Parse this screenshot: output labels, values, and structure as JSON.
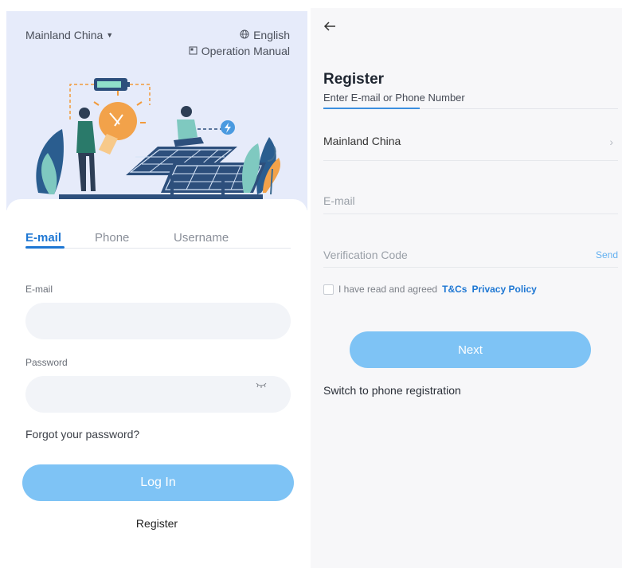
{
  "login": {
    "region": "Mainland China",
    "language": "English",
    "manual": "Operation Manual",
    "tabs": [
      {
        "label": "E-mail",
        "active": true
      },
      {
        "label": "Phone",
        "active": false
      },
      {
        "label": "Username",
        "active": false
      }
    ],
    "email_label": "E-mail",
    "email_value": "",
    "password_label": "Password",
    "password_value": "",
    "forgot": "Forgot your password?",
    "login_button": "Log In",
    "register_link": "Register"
  },
  "register": {
    "title": "Register",
    "subtitle": "Enter E-mail or Phone Number",
    "region": "Mainland China",
    "email_placeholder": "E-mail",
    "code_placeholder": "Verification Code",
    "send": "Send",
    "agree_text": "I have read and agreed",
    "tc": "T&Cs",
    "privacy": "Privacy Policy",
    "next_button": "Next",
    "switch_link": "Switch to phone registration"
  },
  "icons": {
    "caret": "caret-down-icon",
    "globe": "globe-icon",
    "manual": "book-icon",
    "eye": "eye-closed-icon",
    "back": "arrow-left-icon",
    "chevron": "chevron-right-icon"
  },
  "colors": {
    "accent": "#1e77d3",
    "button": "#7ec3f5",
    "hero_bg": "#e6ebfa",
    "send": "#63b0f0"
  }
}
